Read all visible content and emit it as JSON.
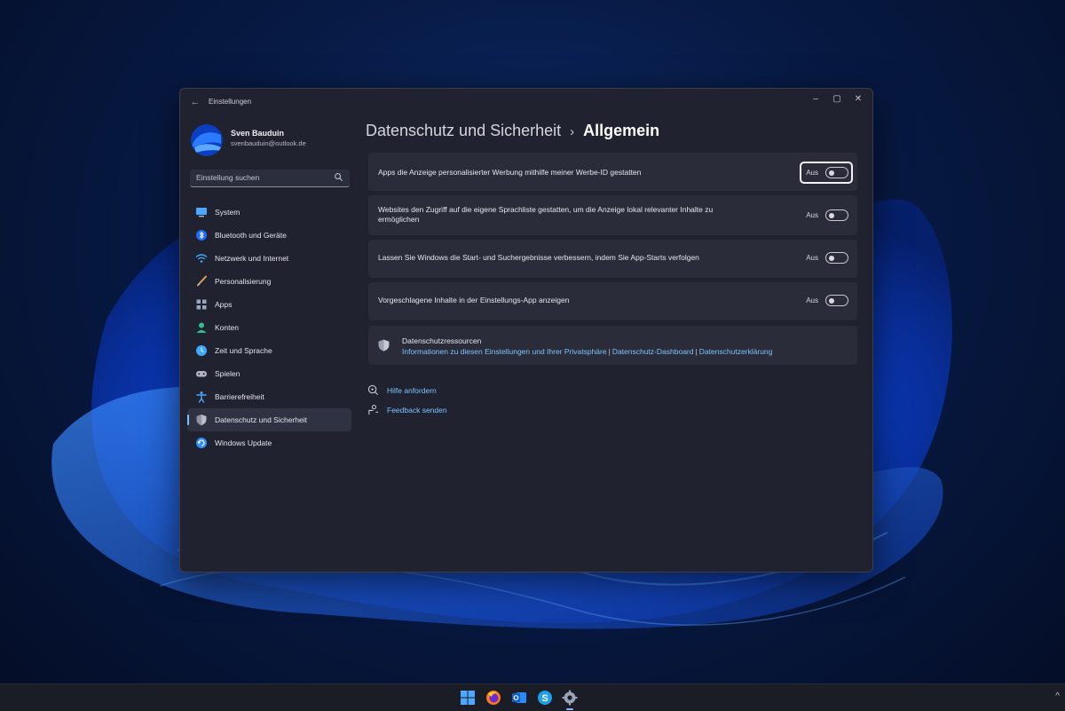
{
  "window": {
    "title": "Einstellungen",
    "back_icon": "arrow-left-icon",
    "controls": {
      "minimize": "–",
      "maximize": "▢",
      "close": "✕"
    }
  },
  "user": {
    "name": "Sven Bauduin",
    "email": "svenbauduin@outlook.de"
  },
  "search": {
    "placeholder": "Einstellung suchen",
    "icon": "search-icon"
  },
  "nav": {
    "items": [
      {
        "label": "System",
        "icon": "monitor-icon",
        "color": "#4aa8ff"
      },
      {
        "label": "Bluetooth und Geräte",
        "icon": "bluetooth-icon",
        "color": "#3d8bff"
      },
      {
        "label": "Netzwerk und Internet",
        "icon": "wifi-icon",
        "color": "#3fa9ff"
      },
      {
        "label": "Personalisierung",
        "icon": "brush-icon",
        "color": "#e0a060"
      },
      {
        "label": "Apps",
        "icon": "apps-grid-icon",
        "color": "#9aa6bf"
      },
      {
        "label": "Konten",
        "icon": "person-icon",
        "color": "#2fbf8f"
      },
      {
        "label": "Zeit und Sprache",
        "icon": "globe-clock-icon",
        "color": "#3fa9ff"
      },
      {
        "label": "Spielen",
        "icon": "gamepad-icon",
        "color": "#b0b6c8"
      },
      {
        "label": "Barrierefreiheit",
        "icon": "accessibility-icon",
        "color": "#4aa8ff"
      },
      {
        "label": "Datenschutz und Sicherheit",
        "icon": "shield-icon",
        "color": "#b8bcc8",
        "active": true
      },
      {
        "label": "Windows Update",
        "icon": "update-icon",
        "color": "#2f8fff"
      }
    ]
  },
  "header": {
    "parent": "Datenschutz und Sicherheit",
    "separator": "›",
    "current": "Allgemein"
  },
  "settings": [
    {
      "text": "Apps die Anzeige personalisierter Werbung mithilfe meiner Werbe-ID gestatten",
      "state": "Aus",
      "on": false,
      "focused": true
    },
    {
      "text": "Websites den Zugriff auf die eigene Sprachliste gestatten, um die Anzeige lokal relevanter Inhalte zu ermöglichen",
      "state": "Aus",
      "on": false
    },
    {
      "text": "Lassen Sie Windows die Start- und Suchergebnisse verbessern, indem Sie App-Starts verfolgen",
      "state": "Aus",
      "on": false
    },
    {
      "text": "Vorgeschlagene Inhalte in der Einstellungs-App anzeigen",
      "state": "Aus",
      "on": false
    }
  ],
  "resources": {
    "title": "Datenschutzressourcen",
    "icon": "shield-icon",
    "links": [
      "Informationen zu diesen Einstellungen und Ihrer Privatsphäre",
      "Datenschutz-Dashboard",
      "Datenschutzerklärung"
    ],
    "separator": "|"
  },
  "help": {
    "get_help": "Hilfe anfordern",
    "feedback": "Feedback senden"
  },
  "taskbar": {
    "icons": [
      "windows-start-icon",
      "firefox-icon",
      "outlook-icon",
      "skype-icon",
      "settings-gear-icon"
    ],
    "tray_chevron": "^"
  },
  "colors": {
    "accent": "#7cc4ff",
    "window_bg": "#202230",
    "card_bg": "#2a2c3a"
  }
}
